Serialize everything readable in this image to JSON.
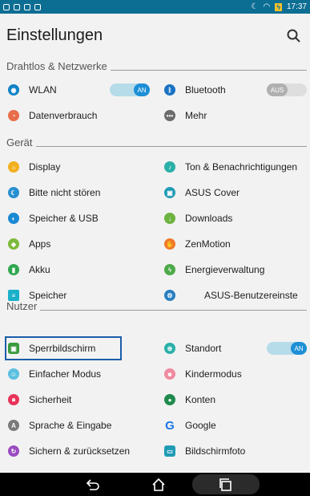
{
  "status_bar": {
    "time": "17:37",
    "battery_icon": "battery-charging-icon"
  },
  "header": {
    "title": "Einstellungen",
    "search_icon": "search-icon"
  },
  "sections": {
    "wireless": "Drahtlos & Netzwerke",
    "device": "Gerät",
    "user": "Nutzer"
  },
  "wireless_items": {
    "wlan": "WLAN",
    "wlan_toggle": "AN",
    "bluetooth": "Bluetooth",
    "bluetooth_toggle": "AUS",
    "data_usage": "Datenverbrauch",
    "more": "Mehr"
  },
  "device_items": {
    "display": "Display",
    "sound": "Ton & Benachrichtigungen",
    "dnd": "Bitte nicht stören",
    "asus_cover": "ASUS Cover",
    "storage_usb": "Speicher & USB",
    "downloads": "Downloads",
    "apps": "Apps",
    "zenmotion": "ZenMotion",
    "battery": "Akku",
    "power_mgmt": "Energieverwaltung",
    "memory": "Speicher",
    "asus_custom": "ASUS-Benutzereinste"
  },
  "user_items": {
    "lockscreen": "Sperrbildschirm",
    "location": "Standort",
    "location_toggle": "AN",
    "easy_mode": "Einfacher Modus",
    "kids_mode": "Kindermodus",
    "security": "Sicherheit",
    "accounts": "Konten",
    "language": "Sprache & Eingabe",
    "google": "Google",
    "backup": "Sichern & zurücksetzen",
    "screensaver": "Bildschirmfoto"
  },
  "colors": {
    "status_bar": "#0d6e93",
    "accent": "#1c8fd6",
    "highlight_border": "#1a5ea8"
  }
}
